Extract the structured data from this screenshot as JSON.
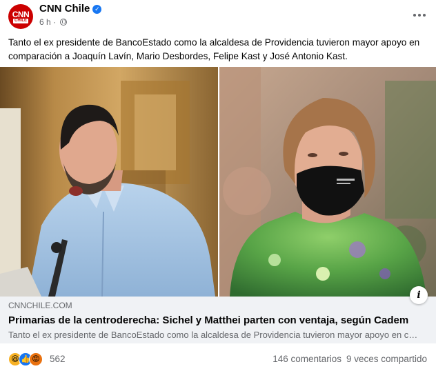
{
  "post": {
    "page_name": "CNN Chile",
    "time": "6 h",
    "time_separator": "·",
    "avatar": {
      "logo_main": "CNN",
      "logo_sub": "CHILE"
    },
    "text": "Tanto el ex presidente de BancoEstado como la alcaldesa de Providencia tuvieron mayor apoyo en comparación a Joaquín Lavín, Mario Desbordes, Felipe Kast y José Antonio Kast."
  },
  "link": {
    "domain": "CNNCHILE.COM",
    "title": "Primarias de la centroderecha: Sichel y Matthei parten con ventaja, según Cadem",
    "description": "Tanto el ex presidente de BancoEstado como la alcaldesa de Providencia tuvieron mayor apoyo en comparación a Joaquín Lavín, Mario Desbordes, Felipe Kast y José Antonio Kast."
  },
  "engagement": {
    "reaction_count": "562",
    "comments": "146 comentarios",
    "shares": "9 veces compartido"
  },
  "icons": {
    "verified": "verified-badge-icon",
    "privacy": "globe-icon",
    "more": "more-options-icon",
    "info": "info-icon",
    "reactions": [
      "haha-icon",
      "like-icon",
      "angry-icon"
    ]
  },
  "colors": {
    "brand": "#cc0000",
    "verified": "#1877f2",
    "secondary_text": "#65676b",
    "link_bg": "#f0f2f5"
  }
}
